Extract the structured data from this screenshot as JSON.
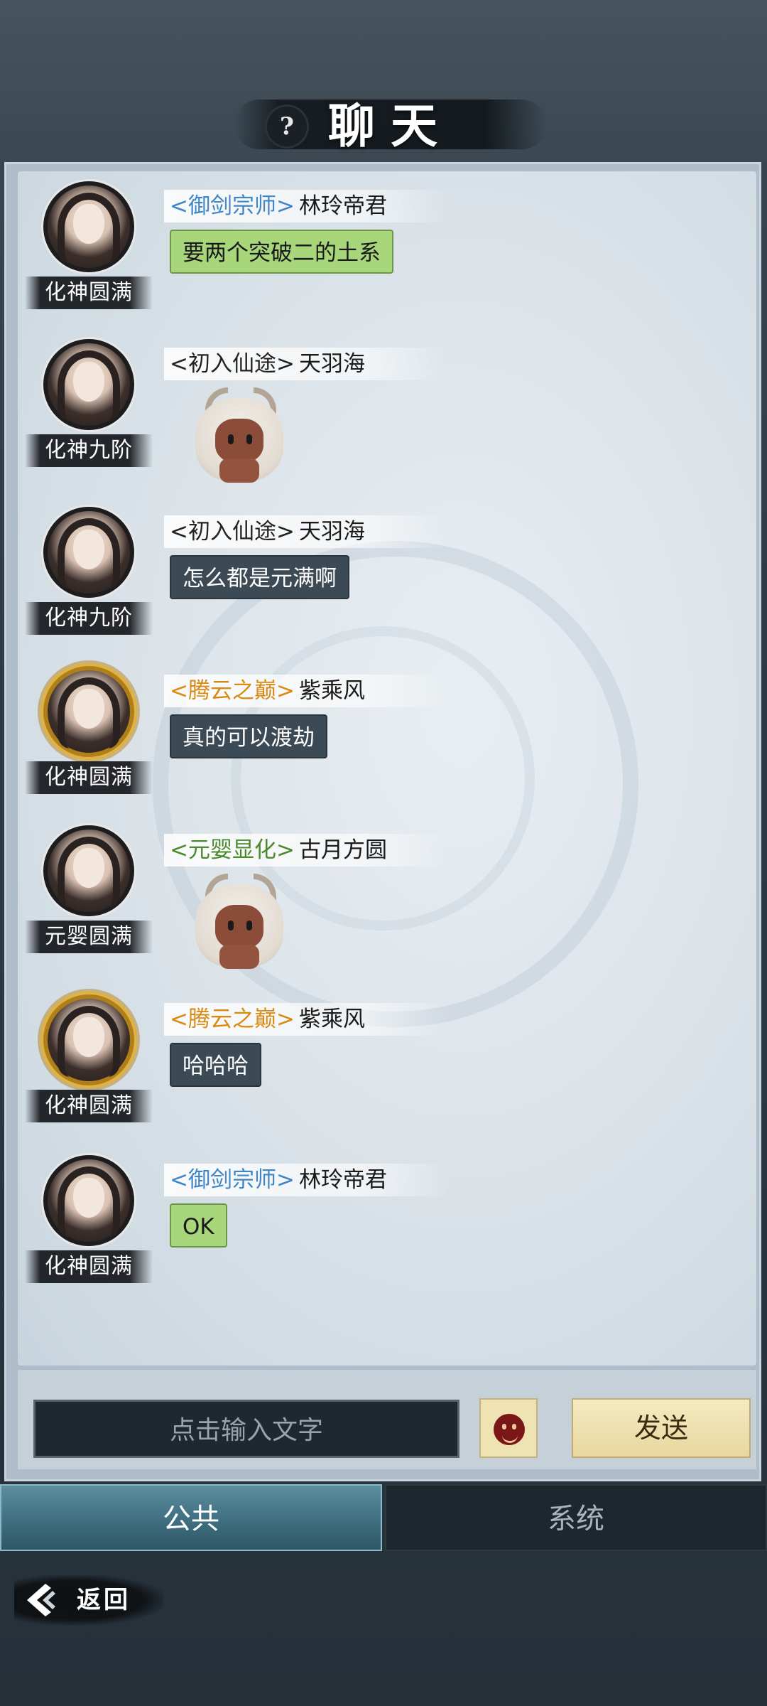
{
  "header": {
    "help_icon": "question-icon",
    "help_symbol": "?",
    "title": "聊天"
  },
  "messages": [
    {
      "rank": "化神圆满",
      "tag": "<御剑宗师>",
      "tag_color": "blue",
      "name": "林玲帝君",
      "type": "text",
      "bubble": "green",
      "text": "要两个突破二的土系",
      "avatar_frame": "plain"
    },
    {
      "rank": "化神九阶",
      "tag": "<初入仙途>",
      "tag_color": "gray",
      "name": "天羽海",
      "type": "sticker",
      "sticker": "deer-plush-sticker",
      "avatar_frame": "plain"
    },
    {
      "rank": "化神九阶",
      "tag": "<初入仙途>",
      "tag_color": "gray",
      "name": "天羽海",
      "type": "text",
      "bubble": "dark",
      "text": "怎么都是元满啊",
      "avatar_frame": "plain"
    },
    {
      "rank": "化神圆满",
      "tag": "<腾云之巅>",
      "tag_color": "orange",
      "name": "紫乘风",
      "type": "text",
      "bubble": "dark",
      "text": "真的可以渡劫",
      "avatar_frame": "gold-dragon"
    },
    {
      "rank": "元婴圆满",
      "tag": "<元婴显化>",
      "tag_color": "green",
      "name": "古月方圆",
      "type": "sticker",
      "sticker": "deer-plush-sticker",
      "avatar_frame": "plain"
    },
    {
      "rank": "化神圆满",
      "tag": "<腾云之巅>",
      "tag_color": "orange",
      "name": "紫乘风",
      "type": "text",
      "bubble": "dark",
      "text": "哈哈哈",
      "avatar_frame": "gold-dragon"
    },
    {
      "rank": "化神圆满",
      "tag": "<御剑宗师>",
      "tag_color": "blue",
      "name": "林玲帝君",
      "type": "text",
      "bubble": "green",
      "text": "OK",
      "avatar_frame": "plain"
    }
  ],
  "input": {
    "placeholder": "点击输入文字",
    "emoji_icon": "smiley-icon",
    "send_label": "发送"
  },
  "tabs": [
    {
      "label": "公共",
      "active": true
    },
    {
      "label": "系统",
      "active": false
    }
  ],
  "back": {
    "label": "返回",
    "icon": "back-arrow-icon"
  },
  "colors": {
    "tag_blue": "#3f86c6",
    "tag_orange": "#d98a12",
    "tag_green": "#4a8a2a",
    "bubble_green": "#a7d67b",
    "bubble_dark": "#3c4a55",
    "send_bg": "#e8d79e"
  }
}
